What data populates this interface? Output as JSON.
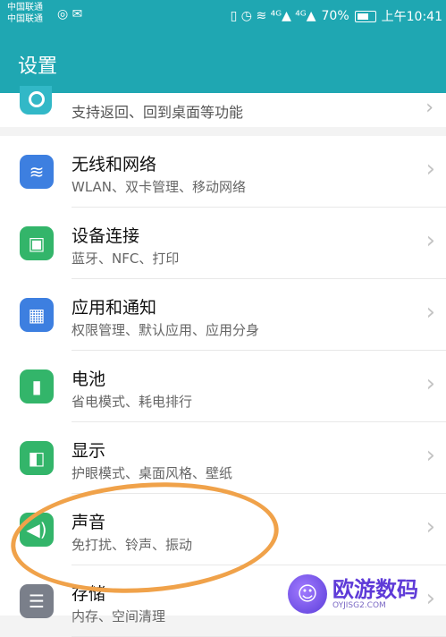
{
  "status_bar": {
    "carrier1": "中国联通",
    "carrier2": "中国联通",
    "left_icons": "◎ ✉",
    "signal_icons": "▯ ◷ ≋ ⁴ᴳ▲ ⁴ᴳ▲",
    "battery_text": "70%",
    "time": "上午10:41"
  },
  "app_bar": {
    "title": "设置"
  },
  "partial_item": {
    "subtitle": "支持返回、回到桌面等功能"
  },
  "items": [
    {
      "title": "无线和网络",
      "subtitle": "WLAN、双卡管理、移动网络",
      "icon": "wifi-icon",
      "color": "#3d7fe0",
      "glyph": "≋"
    },
    {
      "title": "设备连接",
      "subtitle": "蓝牙、NFC、打印",
      "icon": "device-connection-icon",
      "color": "#33b56a",
      "glyph": "▣"
    },
    {
      "title": "应用和通知",
      "subtitle": "权限管理、默认应用、应用分身",
      "icon": "apps-icon",
      "color": "#3d7fe0",
      "glyph": "▦"
    },
    {
      "title": "电池",
      "subtitle": "省电模式、耗电排行",
      "icon": "battery-icon",
      "color": "#33b56a",
      "glyph": "▮"
    },
    {
      "title": "显示",
      "subtitle": "护眼模式、桌面风格、壁纸",
      "icon": "display-icon",
      "color": "#33b56a",
      "glyph": "◧"
    },
    {
      "title": "声音",
      "subtitle": "免打扰、铃声、振动",
      "icon": "sound-icon",
      "color": "#33b56a",
      "glyph": "◀)"
    },
    {
      "title": "存储",
      "subtitle": "内存、空间清理",
      "icon": "storage-icon",
      "color": "#7a7f8a",
      "glyph": "☰"
    }
  ],
  "watermark": {
    "title": "欧游数码",
    "sub": "OYJISG2.COM",
    "logo": "☺"
  }
}
